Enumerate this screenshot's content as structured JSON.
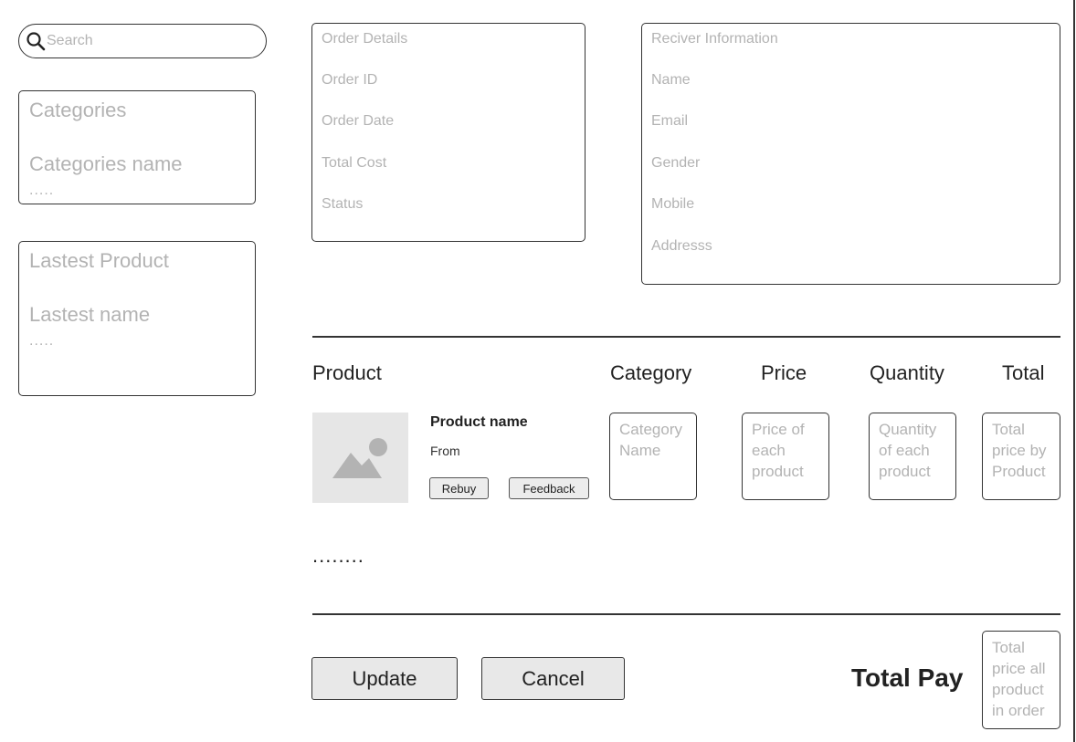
{
  "search": {
    "placeholder": "Search",
    "icon": "search-icon"
  },
  "sidebar": {
    "categories": {
      "title": "Categories",
      "item": "Categories name",
      "more": "....."
    },
    "latest": {
      "title": "Lastest Product",
      "item": "Lastest name",
      "more": "....."
    }
  },
  "order_details": {
    "title": "Order Details",
    "fields": [
      "Order ID",
      "Order Date",
      "Total Cost",
      "Status"
    ]
  },
  "receiver": {
    "title": "Reciver Information",
    "fields": [
      "Name",
      "Email",
      "Gender",
      "Mobile",
      "Addresss"
    ]
  },
  "table": {
    "headers": {
      "product": "Product",
      "category": "Category",
      "price": "Price",
      "quantity": "Quantity",
      "total": "Total"
    },
    "row": {
      "image_icon": "image-placeholder-icon",
      "product_name": "Product name",
      "from": "From",
      "rebuy_label": "Rebuy",
      "feedback_label": "Feedback",
      "category": "Category Name",
      "price": "Price of each product",
      "quantity": "Quantity of each product",
      "total": "Total price by Product"
    },
    "more": "........"
  },
  "footer": {
    "update_label": "Update",
    "cancel_label": "Cancel",
    "total_pay_label": "Total Pay",
    "total_pay_value": "Total price all product in order"
  },
  "colors": {
    "border": "#333333",
    "placeholder_text": "#b3b3b3",
    "button_bg": "#e8e8e8",
    "thumb_bg": "#e6e6e6"
  }
}
